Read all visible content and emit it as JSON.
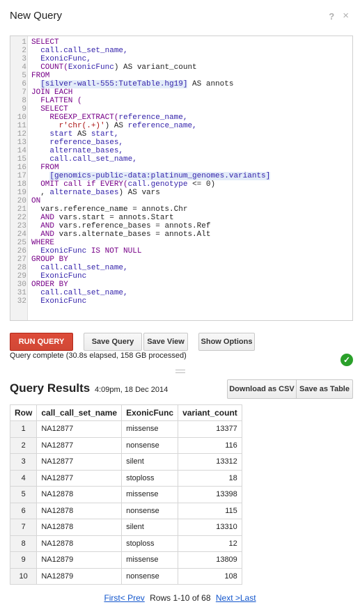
{
  "dialog": {
    "title": "New Query",
    "help_glyph": "?",
    "close_glyph": "×"
  },
  "editor": {
    "lines": [
      {
        "n": "1",
        "segs": [
          {
            "t": "SELECT",
            "c": "kw"
          }
        ]
      },
      {
        "n": "2",
        "segs": [
          {
            "t": "  call.call_set_name,",
            "c": "fn"
          }
        ]
      },
      {
        "n": "3",
        "segs": [
          {
            "t": "  ExonicFunc,",
            "c": "fn"
          }
        ]
      },
      {
        "n": "4",
        "segs": [
          {
            "t": "  COUNT(",
            "c": "kw"
          },
          {
            "t": "ExonicFunc",
            "c": "fn"
          },
          {
            "t": ") AS variant_count",
            "c": "plain"
          }
        ]
      },
      {
        "n": "5",
        "segs": [
          {
            "t": "FROM",
            "c": "kw"
          }
        ]
      },
      {
        "n": "6",
        "segs": [
          {
            "t": "  ",
            "c": "plain"
          },
          {
            "t": "[silver-wall-555:TuteTable.hg19]",
            "c": "tbl"
          },
          {
            "t": " AS annots",
            "c": "plain"
          }
        ]
      },
      {
        "n": "7",
        "segs": [
          {
            "t": "JOIN EACH",
            "c": "kw"
          }
        ]
      },
      {
        "n": "8",
        "segs": [
          {
            "t": "  FLATTEN (",
            "c": "kw"
          }
        ]
      },
      {
        "n": "9",
        "segs": [
          {
            "t": "  SELECT",
            "c": "kw"
          }
        ]
      },
      {
        "n": "10",
        "segs": [
          {
            "t": "    REGEXP_EXTRACT(",
            "c": "kw"
          },
          {
            "t": "reference_name,",
            "c": "fn"
          }
        ]
      },
      {
        "n": "11",
        "segs": [
          {
            "t": "      r'chr(.+)'",
            "c": "str"
          },
          {
            "t": ") AS ",
            "c": "plain"
          },
          {
            "t": "reference_name,",
            "c": "fn"
          }
        ]
      },
      {
        "n": "12",
        "segs": [
          {
            "t": "    start",
            "c": "fn"
          },
          {
            "t": " AS ",
            "c": "plain"
          },
          {
            "t": "start,",
            "c": "fn"
          }
        ]
      },
      {
        "n": "13",
        "segs": [
          {
            "t": "    reference_bases,",
            "c": "fn"
          }
        ]
      },
      {
        "n": "14",
        "segs": [
          {
            "t": "    alternate_bases,",
            "c": "fn"
          }
        ]
      },
      {
        "n": "15",
        "segs": [
          {
            "t": "    call.call_set_name,",
            "c": "fn"
          }
        ]
      },
      {
        "n": "16",
        "segs": [
          {
            "t": "  FROM",
            "c": "kw"
          }
        ]
      },
      {
        "n": "17",
        "segs": [
          {
            "t": "    ",
            "c": "plain"
          },
          {
            "t": "[genomics-public-data:platinum_genomes.variants]",
            "c": "tbl"
          }
        ]
      },
      {
        "n": "18",
        "segs": [
          {
            "t": "  OMIT call if ",
            "c": "kw"
          },
          {
            "t": "EVERY(",
            "c": "kw"
          },
          {
            "t": "call.genotype",
            "c": "fn"
          },
          {
            "t": " <= 0)",
            "c": "plain"
          }
        ]
      },
      {
        "n": "19",
        "segs": [
          {
            "t": "  , ",
            "c": "plain"
          },
          {
            "t": "alternate_bases",
            "c": "fn"
          },
          {
            "t": ") AS vars",
            "c": "plain"
          }
        ]
      },
      {
        "n": "20",
        "segs": [
          {
            "t": "ON",
            "c": "kw"
          }
        ]
      },
      {
        "n": "21",
        "segs": [
          {
            "t": "  vars.reference_name = annots.Chr",
            "c": "plain"
          }
        ]
      },
      {
        "n": "22",
        "segs": [
          {
            "t": "  AND",
            "c": "kw"
          },
          {
            "t": " vars.start = annots.Start",
            "c": "plain"
          }
        ]
      },
      {
        "n": "23",
        "segs": [
          {
            "t": "  AND",
            "c": "kw"
          },
          {
            "t": " vars.reference_bases = annots.Ref",
            "c": "plain"
          }
        ]
      },
      {
        "n": "24",
        "segs": [
          {
            "t": "  AND",
            "c": "kw"
          },
          {
            "t": " vars.alternate_bases = annots.Alt",
            "c": "plain"
          }
        ]
      },
      {
        "n": "25",
        "segs": [
          {
            "t": "WHERE",
            "c": "kw"
          }
        ]
      },
      {
        "n": "26",
        "segs": [
          {
            "t": "  ExonicFunc",
            "c": "fn"
          },
          {
            "t": " IS NOT NULL",
            "c": "kw"
          }
        ]
      },
      {
        "n": "27",
        "segs": [
          {
            "t": "GROUP BY",
            "c": "kw"
          }
        ]
      },
      {
        "n": "28",
        "segs": [
          {
            "t": "  call.call_set_name,",
            "c": "fn"
          }
        ]
      },
      {
        "n": "29",
        "segs": [
          {
            "t": "  ExonicFunc",
            "c": "fn"
          }
        ]
      },
      {
        "n": "30",
        "segs": [
          {
            "t": "ORDER BY",
            "c": "kw"
          }
        ]
      },
      {
        "n": "31",
        "segs": [
          {
            "t": "  call.call_set_name,",
            "c": "fn"
          }
        ]
      },
      {
        "n": "32",
        "segs": [
          {
            "t": "  ExonicFunc",
            "c": "fn"
          }
        ]
      }
    ]
  },
  "toolbar": {
    "run_label": "RUN QUERY",
    "save_query_label": "Save Query",
    "save_view_label": "Save View",
    "show_options_label": "Show Options"
  },
  "status": {
    "text": "Query complete (30.8s elapsed, 158 GB processed)",
    "icon": "check-circle-icon",
    "color": "#2aa02a"
  },
  "results": {
    "title": "Query Results",
    "timestamp": "4:09pm, 18 Dec 2014",
    "download_csv_label": "Download as CSV",
    "save_table_label": "Save as Table",
    "columns": [
      "Row",
      "call_call_set_name",
      "ExonicFunc",
      "variant_count"
    ],
    "rows": [
      {
        "row": "1",
        "name": "NA12877",
        "func": "missense",
        "count": "13377"
      },
      {
        "row": "2",
        "name": "NA12877",
        "func": "nonsense",
        "count": "116"
      },
      {
        "row": "3",
        "name": "NA12877",
        "func": "silent",
        "count": "13312"
      },
      {
        "row": "4",
        "name": "NA12877",
        "func": "stoploss",
        "count": "18"
      },
      {
        "row": "5",
        "name": "NA12878",
        "func": "missense",
        "count": "13398"
      },
      {
        "row": "6",
        "name": "NA12878",
        "func": "nonsense",
        "count": "115"
      },
      {
        "row": "7",
        "name": "NA12878",
        "func": "silent",
        "count": "13310"
      },
      {
        "row": "8",
        "name": "NA12878",
        "func": "stoploss",
        "count": "12"
      },
      {
        "row": "9",
        "name": "NA12879",
        "func": "missense",
        "count": "13809"
      },
      {
        "row": "10",
        "name": "NA12879",
        "func": "nonsense",
        "count": "108"
      }
    ]
  },
  "pagination": {
    "first": "First",
    "prev": "< Prev",
    "range": "Rows 1-10 of 68",
    "next": "Next >",
    "last": "Last"
  },
  "colors": {
    "run_button": "#d14836",
    "link": "#1155cc",
    "keyword": "#770088",
    "identifier": "#3322aa",
    "string": "#aa1111"
  }
}
